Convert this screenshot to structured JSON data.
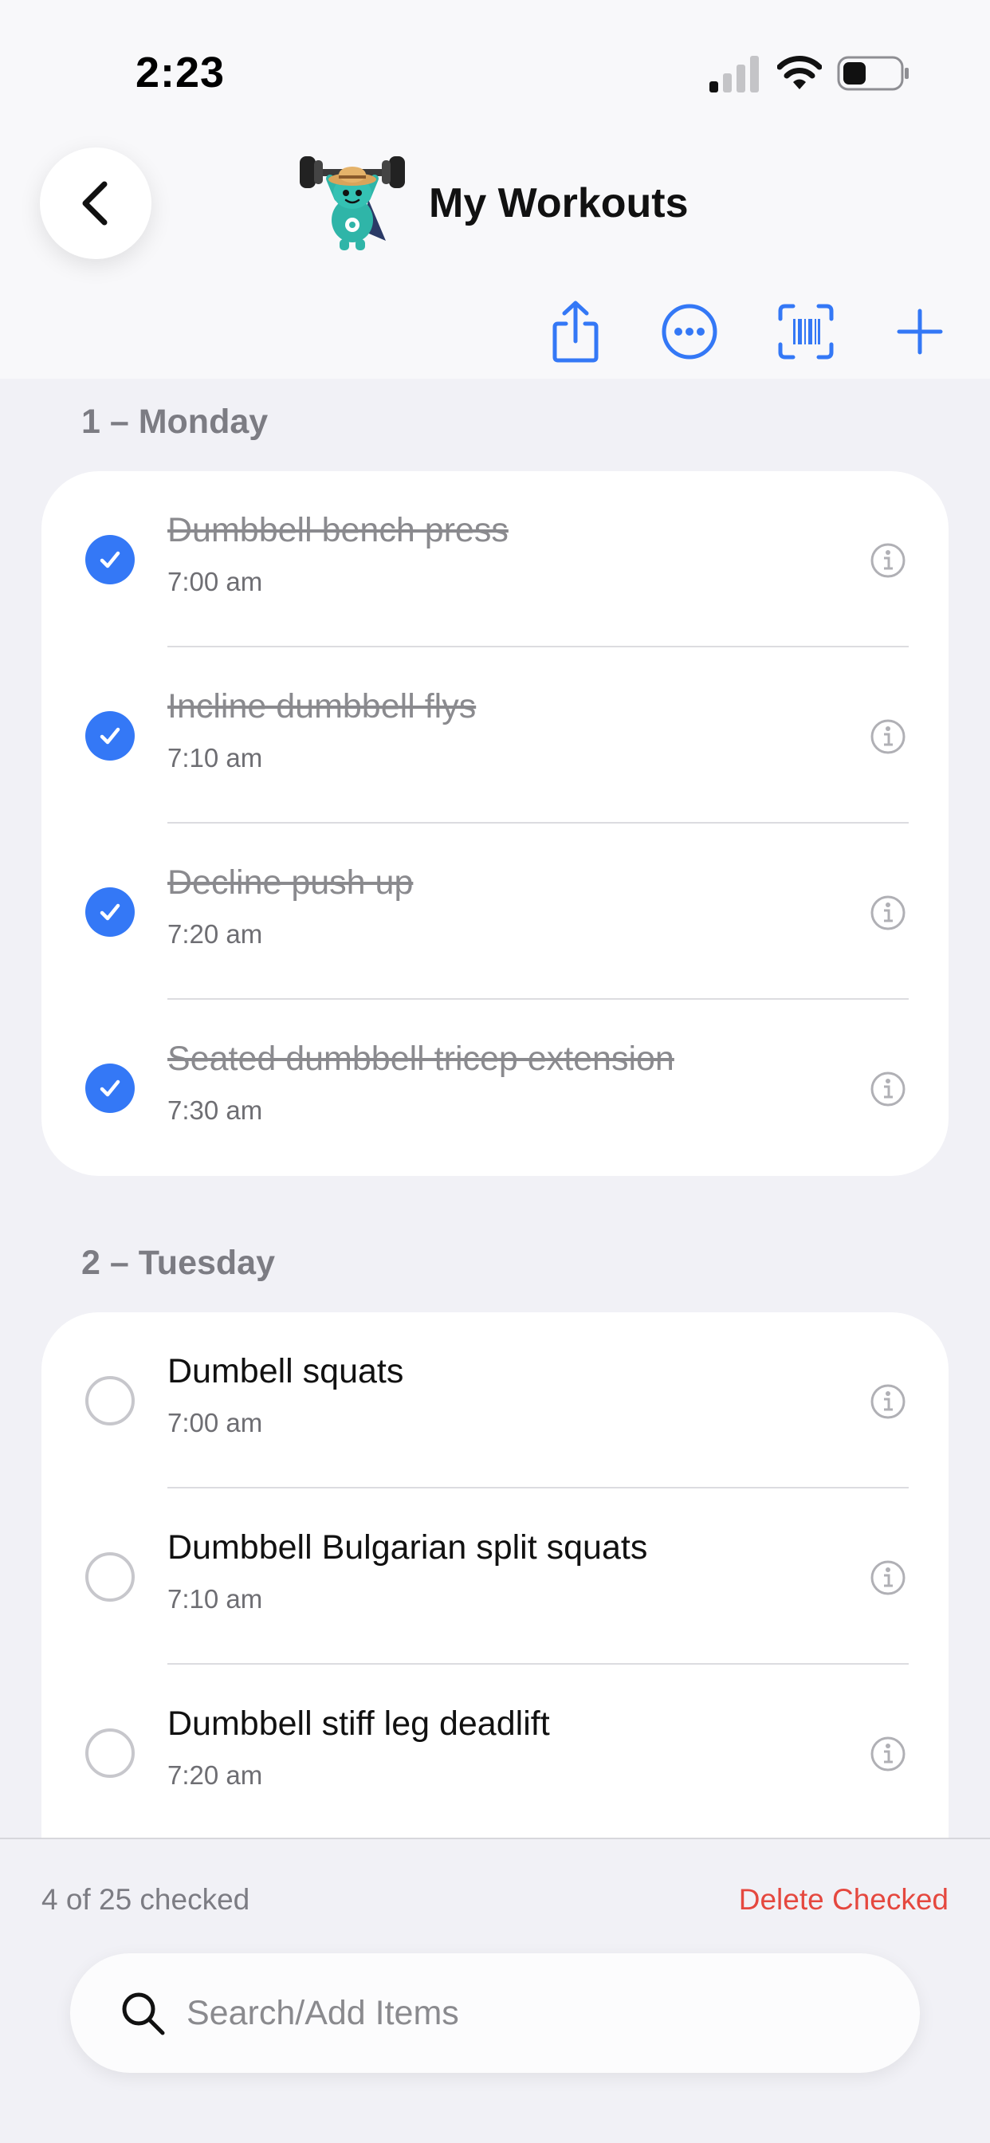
{
  "status_bar": {
    "time": "2:23"
  },
  "header": {
    "title": "My Workouts"
  },
  "toolbar": {
    "icons": [
      "share-icon",
      "more-icon",
      "barcode-scan-icon",
      "plus-icon"
    ],
    "accent_color": "#3478f6"
  },
  "sections": [
    {
      "header": "1 – Monday",
      "items": [
        {
          "title": "Dumbbell bench press",
          "time": "7:00 am",
          "checked": true
        },
        {
          "title": "Incline dumbbell flys",
          "time": "7:10 am",
          "checked": true
        },
        {
          "title": "Decline push up",
          "time": "7:20 am",
          "checked": true
        },
        {
          "title": "Seated dumbbell tricep extension",
          "time": "7:30 am",
          "checked": true
        }
      ]
    },
    {
      "header": "2 – Tuesday",
      "items": [
        {
          "title": "Dumbell squats",
          "time": "7:00 am",
          "checked": false
        },
        {
          "title": "Dumbbell Bulgarian split squats",
          "time": "7:10 am",
          "checked": false
        },
        {
          "title": "Dumbbell stiff leg deadlift",
          "time": "7:20 am",
          "checked": false
        }
      ]
    }
  ],
  "footer": {
    "checked_count": "4 of 25 checked",
    "delete_label": "Delete Checked",
    "delete_color": "#e5483f"
  },
  "search": {
    "placeholder": "Search/Add Items"
  }
}
